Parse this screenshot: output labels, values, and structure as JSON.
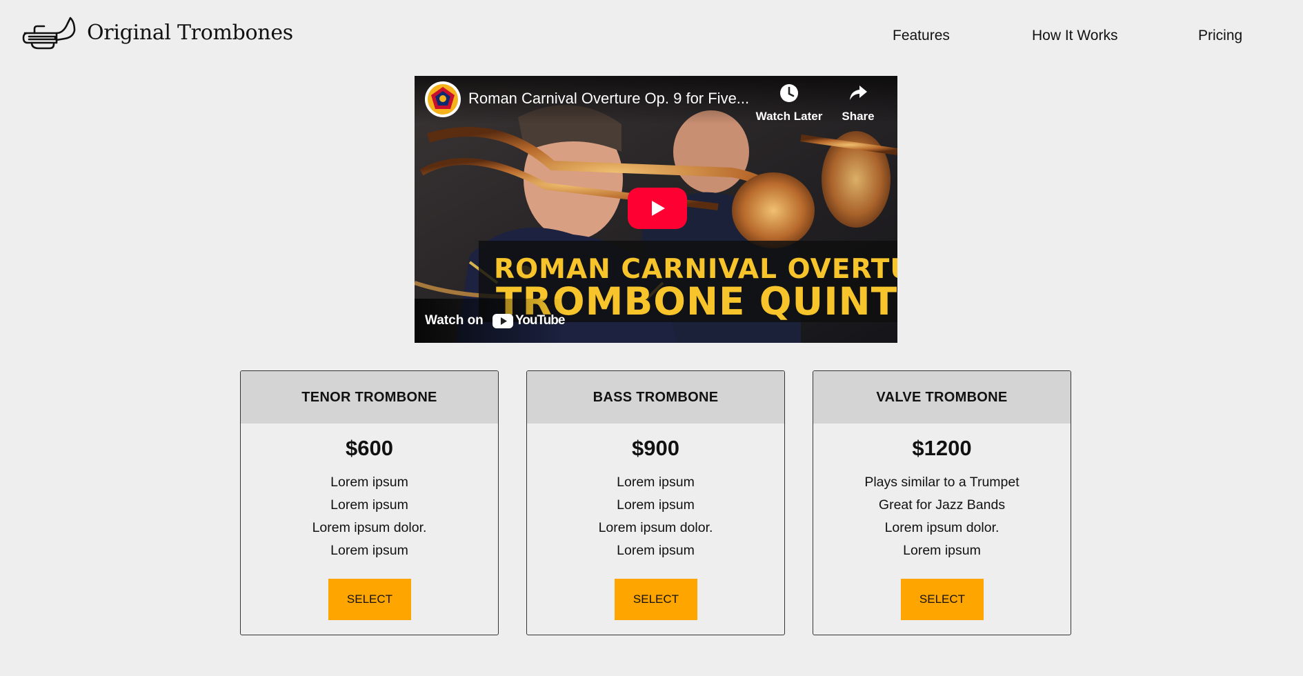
{
  "header": {
    "brand": "Original Trombones",
    "logo_icon": "trombone-icon",
    "nav": [
      {
        "label": "Features"
      },
      {
        "label": "How It Works"
      },
      {
        "label": "Pricing"
      }
    ]
  },
  "video": {
    "title": "Roman Carnival Overture Op. 9 for Five...",
    "watch_later": "Watch Later",
    "share": "Share",
    "overlay_line1": "ROMAN CARNIVAL OVERTURE",
    "overlay_line2": "TROMBONE QUINTET",
    "watch_on": "Watch on",
    "youtube": "YouTube",
    "colors": {
      "play": "#ff0033",
      "overlay_text": "#f7c52b"
    }
  },
  "products": [
    {
      "name": "TENOR TROMBONE",
      "price": "$600",
      "features": [
        "Lorem ipsum",
        "Lorem ipsum",
        "Lorem ipsum dolor.",
        "Lorem ipsum"
      ],
      "button": "SELECT"
    },
    {
      "name": "BASS TROMBONE",
      "price": "$900",
      "features": [
        "Lorem ipsum",
        "Lorem ipsum",
        "Lorem ipsum dolor.",
        "Lorem ipsum"
      ],
      "button": "SELECT"
    },
    {
      "name": "VALVE TROMBONE",
      "price": "$1200",
      "features": [
        "Plays similar to a Trumpet",
        "Great for Jazz Bands",
        "Lorem ipsum dolor.",
        "Lorem ipsum"
      ],
      "button": "SELECT"
    }
  ],
  "colors": {
    "background": "#eeeeee",
    "card_header": "#d4d4d4",
    "button": "#ffa500"
  }
}
